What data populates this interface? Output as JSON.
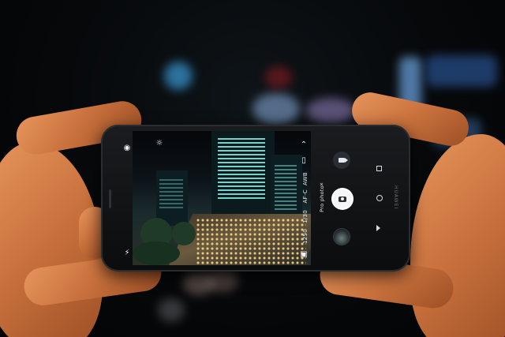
{
  "camera_app": {
    "mode_label": "Pro photo",
    "mode_close": "×",
    "settings": {
      "iso": "1250",
      "shutter": "1/30",
      "focus": "AF-C",
      "wb": "AWB"
    },
    "brand": "HUAWEI"
  },
  "icons": {
    "flash": "flash-off-icon",
    "filter": "aperture-icon",
    "settings": "sun-icon",
    "expand": "chevron-up-icon",
    "exposure": "exposure-icon",
    "video": "video-icon",
    "shutter": "camera-shutter-icon",
    "gallery": "gallery-thumbnail-icon",
    "nav_recent": "square-icon",
    "nav_home": "circle-icon",
    "nav_back": "triangle-back-icon"
  },
  "colors": {
    "skin": "#d17a43",
    "phone_body": "#121417",
    "window_lights": "#8cf0e6",
    "street_lights": "#ffdc8a"
  }
}
